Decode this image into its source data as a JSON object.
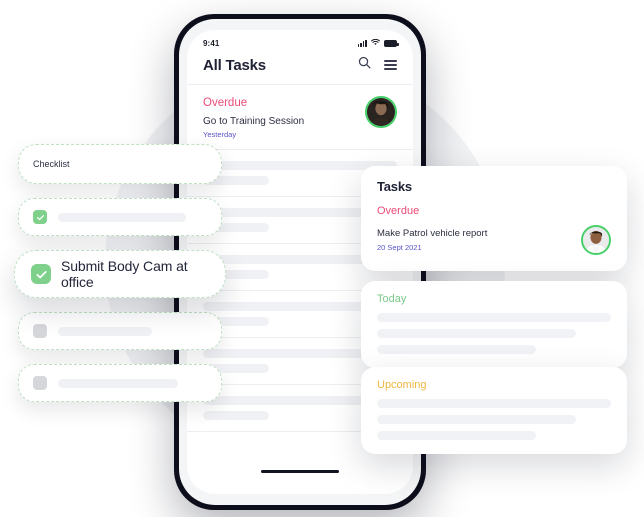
{
  "phone": {
    "status_bar": {
      "time": "9:41",
      "signal_icon": "signal-icon",
      "wifi_icon": "wifi-icon",
      "battery_icon": "battery-icon"
    },
    "header": {
      "title": "All Tasks",
      "search_icon": "search-icon",
      "menu_icon": "hamburger-menu-icon"
    },
    "overdue_task": {
      "section_label": "Overdue",
      "title": "Go to Training Session",
      "date": "Yesterday",
      "avatar": "user-avatar"
    },
    "skeleton_rows": [
      {
        "long": "",
        "short": ""
      },
      {
        "long": "",
        "short": ""
      },
      {
        "long": "",
        "short": ""
      },
      {
        "long": "",
        "short": ""
      },
      {
        "long": "",
        "short": ""
      },
      {
        "long": "",
        "short": ""
      }
    ],
    "home_indicator": "home-indicator"
  },
  "checklist": {
    "header_label": "Checklist",
    "items": [
      {
        "checked": true,
        "label": ""
      },
      {
        "checked": true,
        "label": "Submit Body Cam at office"
      },
      {
        "checked": false,
        "label": ""
      },
      {
        "checked": false,
        "label": ""
      }
    ]
  },
  "panels": {
    "tasks": {
      "title": "Tasks",
      "section_label": "Overdue",
      "task_title": "Make Patrol vehicle report",
      "task_date": "20 Sept 2021",
      "avatar": "user-avatar"
    },
    "today": {
      "section_label": "Today",
      "placeholder_rows": 3
    },
    "upcoming": {
      "section_label": "Upcoming",
      "placeholder_rows": 3
    }
  },
  "colors": {
    "overdue": "#ec4b78",
    "today": "#7cc98a",
    "upcoming": "#f0b741",
    "date_text": "#5b55c8",
    "checkbox_checked": "#7ed08a",
    "checkbox_unchecked": "#d5d7da",
    "avatar_ring": "#46d16a",
    "phone_frame": "#0d0e1c",
    "backdrop": "#f2f3f5"
  }
}
